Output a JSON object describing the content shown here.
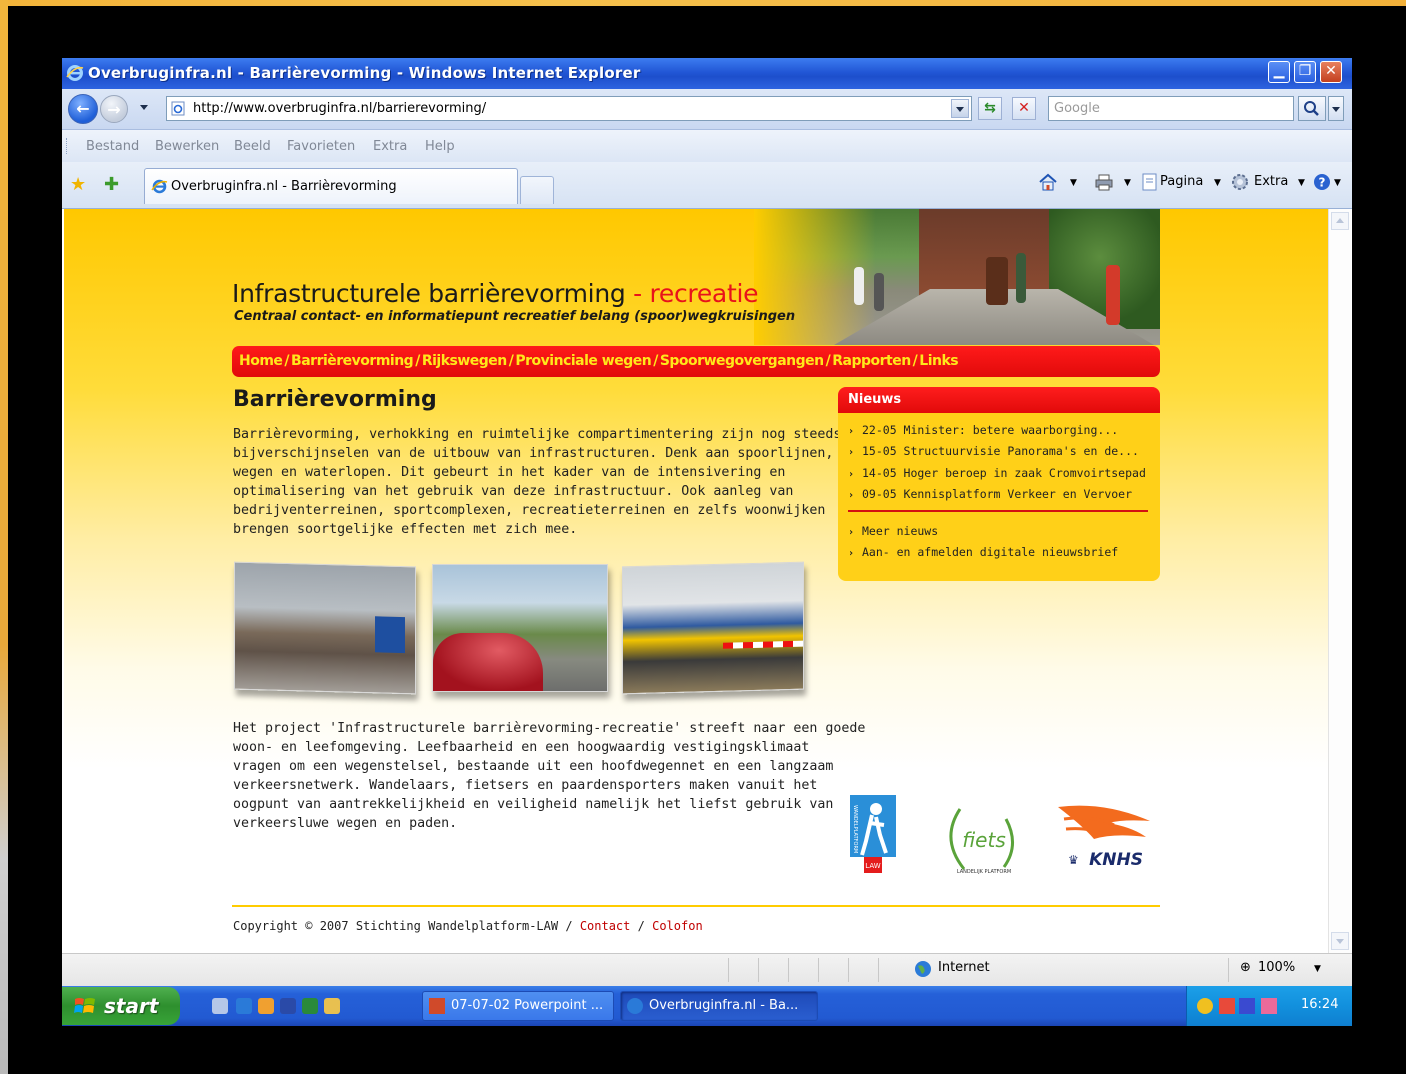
{
  "window": {
    "title": "Overbruginfra.nl - Barrièrevorming - Windows Internet Explorer"
  },
  "addressbar": {
    "url": "http://www.overbruginfra.nl/barrierevorming/",
    "search_placeholder": "Google"
  },
  "menu": [
    "Bestand",
    "Bewerken",
    "Beeld",
    "Favorieten",
    "Extra",
    "Help"
  ],
  "tab": {
    "label": "Overbruginfra.nl - Barrièrevorming"
  },
  "commandbar": {
    "page": "Pagina",
    "tools": "Extra"
  },
  "site": {
    "title_main": "Infrastructurele barrièrevorming",
    "title_accent": "- recreatie",
    "subtitle": "Centraal contact- en informatiepunt recreatief belang (spoor)wegkruisingen",
    "nav": [
      "Home",
      "Barrièrevorming",
      "Rijkswegen",
      "Provinciale wegen",
      "Spoorwegovergangen",
      "Rapporten",
      "Links"
    ],
    "nav_sep": "/"
  },
  "article": {
    "heading": "Barrièrevorming",
    "para1": [
      "Barrièrevorming, verhokking en ruimtelijke compartimentering zijn nog steeds",
      "bijverschijnselen van de uitbouw van infrastructuren. Denk aan spoorlijnen,",
      "wegen en waterlopen. Dit gebeurt in het kader van de intensivering en",
      "optimalisering van het gebruik van deze infrastructuur. Ook aanleg van",
      "bedrijventerreinen, sportcomplexen, recreatieterreinen en zelfs woonwijken",
      "brengen soortgelijke effecten met zich mee."
    ],
    "para2": [
      "Het project 'Infrastructurele barrièrevorming-recreatie' streeft naar een goede",
      "woon- en leefomgeving. Leefbaarheid en een hoogwaardig vestigingsklimaat",
      "vragen om een wegenstelsel, bestaande uit een hoofdwegennet en een langzaam",
      "verkeersnetwerk. Wandelaars, fietsers en paardensporters maken vanuit het",
      "oogpunt van aantrekkelijkheid en veiligheid namelijk het liefst gebruik van",
      "verkeersluwe wegen en paden."
    ]
  },
  "news": {
    "title": "Nieuws",
    "items": [
      "22-05 Minister: betere waarborging...",
      "15-05 Structuurvisie Panorama's en de...",
      "14-05 Hoger beroep in zaak Cromvoirtsepad",
      "09-05 Kennisplatform Verkeer en Vervoer"
    ],
    "links": [
      "Meer nieuws",
      "Aan- en afmelden digitale nieuwsbrief"
    ]
  },
  "logos": {
    "knhs_text": "KNHS",
    "fiets_text": "fiets",
    "fiets_ring": "LANDELIJK PLATFORM",
    "law_text": "LAW",
    "law_vertical": "WANDELPLATFORM"
  },
  "footer": {
    "copyright": "Copyright © 2007 Stichting Wandelplatform-LAW",
    "sep": "/",
    "contact": "Contact",
    "colofon": "Colofon"
  },
  "statusbar": {
    "zone": "Internet",
    "zoom": "100%"
  },
  "taskbar": {
    "start": "start",
    "buttons": [
      "07-07-02 Powerpoint ...",
      "Overbruginfra.nl - Ba..."
    ],
    "clock": "16:24"
  },
  "colors": {
    "accent_red": "#e8121b",
    "nav_yellow": "#ffe81a",
    "page_yellow": "#ffc800"
  }
}
